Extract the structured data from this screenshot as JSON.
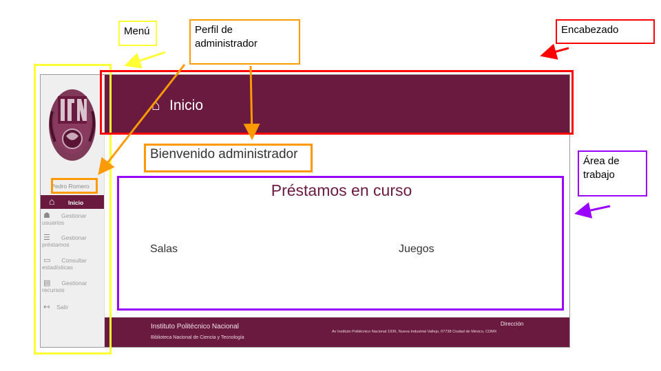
{
  "app": {
    "header_title": "Inicio",
    "user_name": "Pedro Romero",
    "welcome_text": "Bienvenido administrador",
    "work_title": "Préstamos en curso",
    "sections": [
      "Salas",
      "Juegos"
    ],
    "nav": [
      {
        "label": "Inicio",
        "icon": "home-icon",
        "active": true
      },
      {
        "label_line1": "Gestionar",
        "label_line2": "usuarios",
        "icon": "users-icon"
      },
      {
        "label_line1": "Gestionar",
        "label_line2": "préstamos",
        "icon": "loans-icon"
      },
      {
        "label_line1": "Consultar",
        "label_line2": "estadísticas",
        "icon": "stats-icon"
      },
      {
        "label_line1": "Gestionar",
        "label_line2": "recursos",
        "icon": "resources-icon"
      },
      {
        "label_line1": "Salir",
        "label_line2": "",
        "icon": "logout-icon"
      }
    ],
    "footer": {
      "institution": "Instituto Politécnico Nacional",
      "library": "Biblioteca Nacional de Ciencia y Tecnología",
      "address_label": "Dirección",
      "address": "Av Instituto Politécnico Nacional 1936, Nueva Industrial Vallejo, 07738 Ciudad de México, CDMX"
    }
  },
  "annotations": {
    "menu": "Menú",
    "profile_line1": "Perfil de",
    "profile_line2": "administrador",
    "header": "Encabezado",
    "work_line1": "Área de",
    "work_line2": "trabajo"
  },
  "colors": {
    "brand": "#6b1a3f",
    "menu": "#ffff33",
    "profile": "#ff9900",
    "header": "#ff0000",
    "work_area": "#9900ff"
  }
}
